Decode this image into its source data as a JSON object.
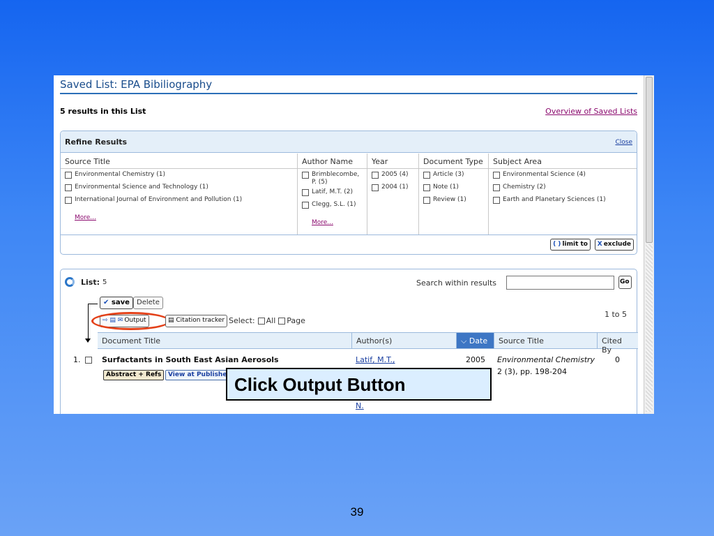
{
  "page": {
    "title": "Saved List: EPA Bibiliography",
    "results_count": "5 results in this List",
    "overview_link": "Overview of Saved Lists"
  },
  "refine": {
    "title": "Refine Results",
    "close": "Close",
    "columns": {
      "source": {
        "header": "Source Title",
        "items": [
          "Environmental Chemistry (1)",
          "Environmental Science and Technology (1)",
          "International Journal of Environment and Pollution (1)"
        ],
        "more": "More..."
      },
      "author": {
        "header": "Author Name",
        "items": [
          "Brimblecombe, P. (5)",
          "Latif, M.T. (2)",
          "Clegg, S.L. (1)"
        ],
        "more": "More..."
      },
      "year": {
        "header": "Year",
        "items": [
          "2005 (4)",
          "2004 (1)"
        ]
      },
      "doctype": {
        "header": "Document Type",
        "items": [
          "Article (3)",
          "Note (1)",
          "Review (1)"
        ]
      },
      "subject": {
        "header": "Subject Area",
        "items": [
          "Environmental Science (4)",
          "Chemistry (2)",
          "Earth and Planetary Sciences (1)"
        ]
      }
    },
    "limit_to": "limit to",
    "exclude": "exclude"
  },
  "list": {
    "label": "List:",
    "count": "5",
    "search_within_label": "Search within results",
    "search_value": "",
    "go": "Go",
    "save": "save",
    "delete": "Delete",
    "output": "Output",
    "citation_tracker": "Citation tracker",
    "select_label": "Select:",
    "select_all": "All",
    "select_page": "Page",
    "range": "1 to 5",
    "columns": {
      "doc_title": "Document Title",
      "authors": "Author(s)",
      "date": "Date",
      "source": "Source Title",
      "cited_by": "Cited By"
    },
    "rows": [
      {
        "num": "1.",
        "title": "Surfactants in South East Asian Aerosols",
        "abstract_btn": "Abstract + Refs",
        "publisher_btn": "View at Publisher",
        "author_first": "Latif, M.T.,",
        "author_last": "N.",
        "date": "2005",
        "source": "Environmental Chemistry",
        "source_detail": "2 (3), pp. 198-204",
        "cited_by": "0"
      }
    ]
  },
  "callout": {
    "text": "Click Output Button"
  },
  "slide_number": "39"
}
